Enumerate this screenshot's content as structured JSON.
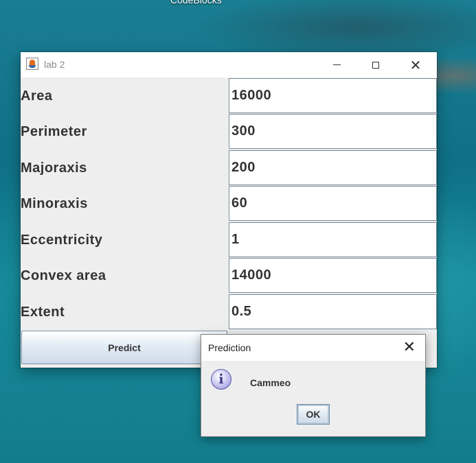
{
  "desktop": {
    "label": "CodeBlocks"
  },
  "window": {
    "title": "lab 2",
    "icon": "java-icon",
    "controls": {
      "minimize": "minimize-icon",
      "maximize": "maximize-icon",
      "close": "close-icon"
    }
  },
  "form": {
    "rows": [
      {
        "label": "Area",
        "value": "16000"
      },
      {
        "label": "Perimeter",
        "value": "300"
      },
      {
        "label": "Majoraxis",
        "value": "200"
      },
      {
        "label": "Minoraxis",
        "value": "60"
      },
      {
        "label": "Eccentricity",
        "value": "1"
      },
      {
        "label": "Convex area",
        "value": "14000"
      },
      {
        "label": "Extent",
        "value": "0.5"
      }
    ],
    "predict_label": "Predict"
  },
  "dialog": {
    "title": "Prediction",
    "icon": "info-icon",
    "icon_glyph": "i",
    "message": "Cammeo",
    "ok_label": "OK"
  }
}
